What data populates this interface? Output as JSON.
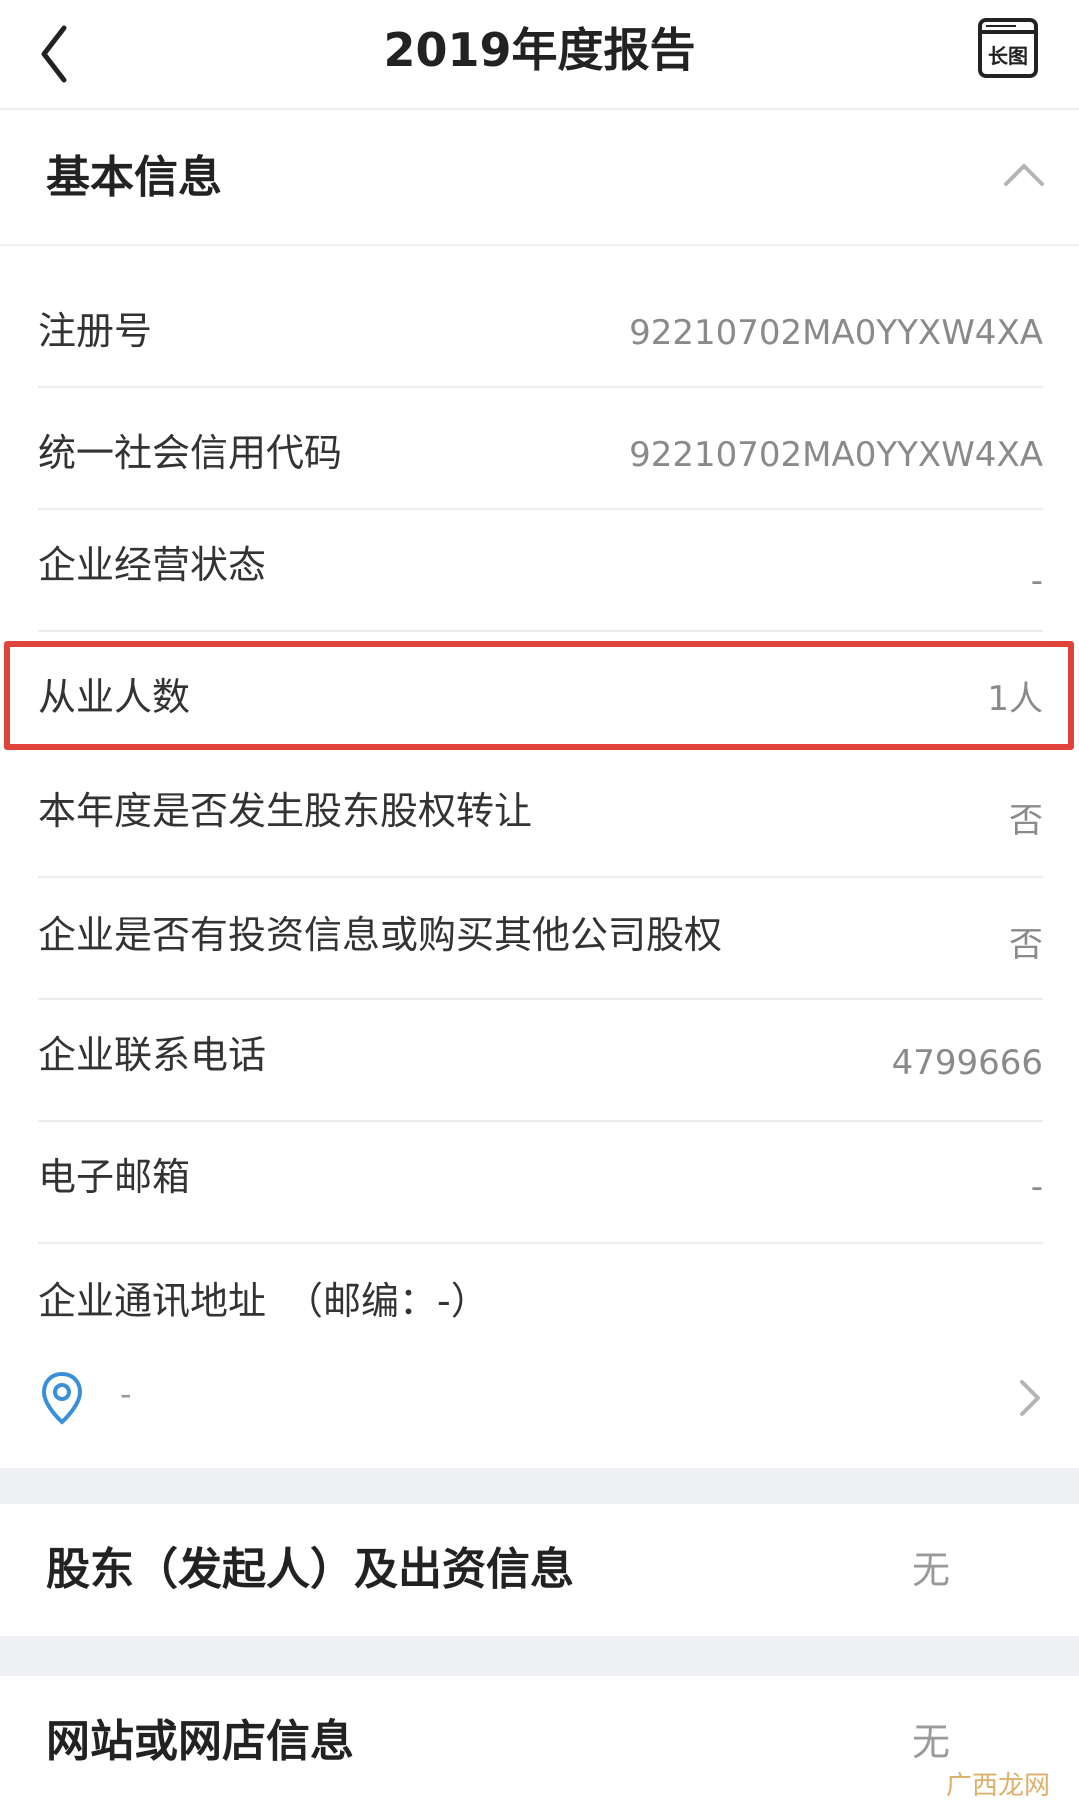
{
  "header": {
    "title": "2019年度报告",
    "long_image_label": "长图"
  },
  "basic_info": {
    "title": "基本信息",
    "rows": [
      {
        "label": "注册号",
        "value": "92210702MA0YYXW4XA"
      },
      {
        "label": "统一社会信用代码",
        "value": "92210702MA0YYXW4XA"
      },
      {
        "label": "企业经营状态",
        "value": "-"
      },
      {
        "label": "从业人数",
        "value": "1人"
      },
      {
        "label": "本年度是否发生股东股权转让",
        "value": "否"
      },
      {
        "label": "企业是否有投资信息或购买其他公司股权",
        "value": "否"
      },
      {
        "label": "企业联系电话",
        "value": "4799666"
      },
      {
        "label": "电子邮箱",
        "value": "-"
      }
    ],
    "address": {
      "label": "企业通讯地址　（邮编：-）",
      "value": "-"
    }
  },
  "sections": [
    {
      "title": "股东（发起人）及出资信息",
      "status": "无"
    },
    {
      "title": "网站或网店信息",
      "status": "无"
    }
  ],
  "watermark": "广西龙网",
  "colors": {
    "highlight": "#e0433a",
    "pin": "#3a8fd9",
    "gap": "#eef0f4"
  },
  "icons": [
    "back-arrow-icon",
    "long-image-icon",
    "chevron-up-icon",
    "location-pin-icon",
    "chevron-right-icon"
  ]
}
